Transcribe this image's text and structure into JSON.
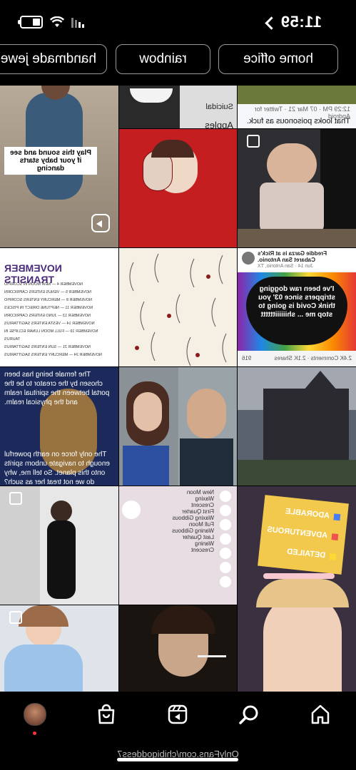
{
  "status": {
    "time": "11:59"
  },
  "filters": [
    {
      "label": "home office"
    },
    {
      "label": "rainbow"
    },
    {
      "label": "handmade jewelry"
    }
  ],
  "grid": {
    "baby_reel_text": "Play this sound and see if your baby starts dancing",
    "signs_text_1": "Suicidal",
    "signs_text_2": "Apples",
    "tweet_meta": "12:29 PM · 07 Mar 21 · Twitter for Android",
    "tweet_text": "That looks poisonous as fuck.",
    "transits_title": "NOVEMBER TRANSITS",
    "transits_rows": [
      "NOVEMBER 4 — NEW MOON IN SCORPIO",
      "NOVEMBER 5 — VENUS ENTERS CAPRICORN",
      "NOVEMBER 8 — MERCURY ENTERS SCORPIO",
      "NOVEMBER 11 — NEPTUNE DIRECT IN PISCES",
      "NOVEMBER 13 — JUNO ENTERS CAPRICORN",
      "NOVEMBER 14 — VESTA ENTERS SAGITTARIUS",
      "NOVEMBER 19 — FULL MOON LUNAR ECLIPSE IN TAURUS",
      "NOVEMBER 21 — SUN ENTERS SAGITTARIUS",
      "NOVEMBER 24 — MERCURY ENTERS SAGITTARIUS"
    ],
    "fb_name": "Freddie Garza is at Rick's Cabaret San Antonio.",
    "fb_sub": "Jun 14 · San Antonio, TX",
    "heart_text": "I've been raw dogging strippers since 03' you think Covid is going to stop me ... shiiiiiitttttt",
    "fb_stats": "2.4K Comments · 2.1K Shares",
    "fb_reactions": "916",
    "spirit_text_1": "The female being has been chosen by the creator to be the portal between the spiritual realm and the physical realm.",
    "spirit_text_2": "The only force on earth powerful enough to navigate unborn spirits onto this planet. So tell me, why do we not treat her as such?",
    "moon_phases": [
      "New Moon",
      "Waxing Crescent",
      "First Quarter",
      "Waxing Gibbous",
      "Full Moon",
      "Waning Gibbous",
      "Last Quarter",
      "Waning Crescent"
    ],
    "filter_items": [
      "ADORABLE",
      "ADVENTUROUS",
      "DETAILED"
    ]
  },
  "nav": {
    "items": [
      "home",
      "search",
      "reels",
      "shop",
      "profile"
    ]
  },
  "watermark": "OnlyFans.com/chibigoddess7"
}
